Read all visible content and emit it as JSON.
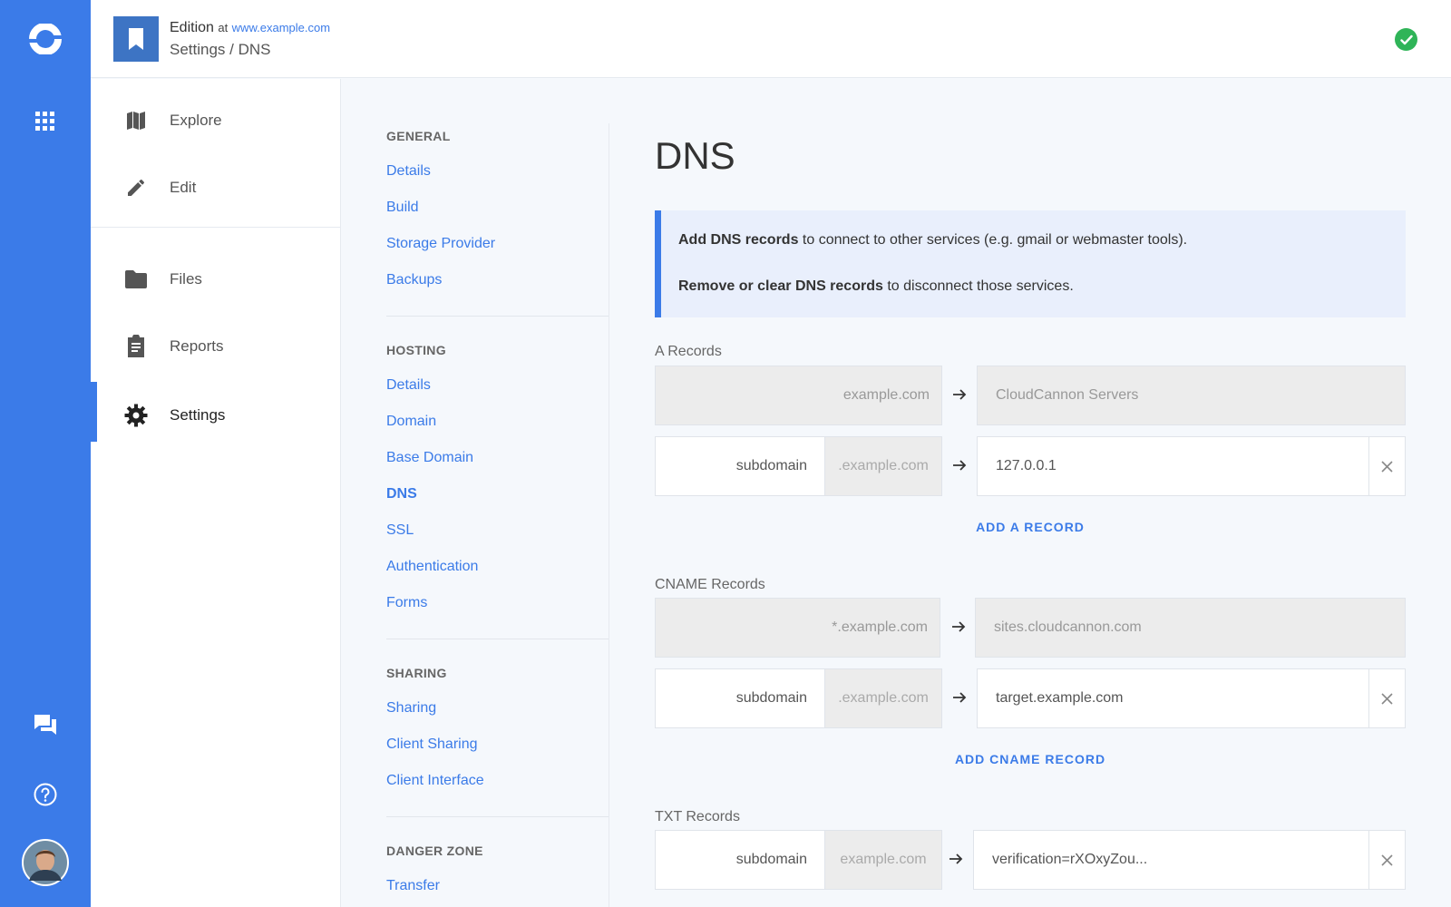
{
  "header": {
    "site_name": "Edition",
    "at_label": "at",
    "site_url": "www.example.com",
    "breadcrumb": "Settings / DNS"
  },
  "nav": {
    "items": [
      {
        "label": "Explore",
        "icon": "map-icon"
      },
      {
        "label": "Edit",
        "icon": "pencil-icon"
      },
      {
        "label": "Files",
        "icon": "folder-icon"
      },
      {
        "label": "Reports",
        "icon": "clipboard-icon"
      },
      {
        "label": "Settings",
        "icon": "gear-icon",
        "active": true
      }
    ]
  },
  "subnav": {
    "general": {
      "title": "GENERAL",
      "links": [
        "Details",
        "Build",
        "Storage Provider",
        "Backups"
      ]
    },
    "hosting": {
      "title": "HOSTING",
      "links": [
        "Details",
        "Domain",
        "Base Domain",
        "DNS",
        "SSL",
        "Authentication",
        "Forms"
      ]
    },
    "sharing": {
      "title": "SHARING",
      "links": [
        "Sharing",
        "Client Sharing",
        "Client Interface"
      ]
    },
    "danger": {
      "title": "DANGER ZONE",
      "links": [
        "Transfer"
      ]
    },
    "current": "DNS"
  },
  "main": {
    "title": "DNS",
    "info": {
      "line1_bold": "Add DNS records",
      "line1_rest": " to connect to other services (e.g. gmail or webmaster tools).",
      "line2_bold": "Remove or clear DNS records",
      "line2_rest": " to disconnect those services."
    },
    "a_records": {
      "label": "A Records",
      "fixed_host": "example.com",
      "fixed_target": "CloudCannon Servers",
      "row_name": "subdomain",
      "row_domain": ".example.com",
      "row_target": "127.0.0.1",
      "add_label": "ADD A RECORD"
    },
    "cname_records": {
      "label": "CNAME Records",
      "fixed_host": "*.example.com",
      "fixed_target": "sites.cloudcannon.com",
      "row_name": "subdomain",
      "row_domain": ".example.com",
      "row_target": "target.example.com",
      "add_label": "ADD CNAME RECORD"
    },
    "txt_records": {
      "label": "TXT Records",
      "row_name": "subdomain",
      "row_domain": "example.com",
      "row_target": "verification=rXOxyZou..."
    }
  },
  "colors": {
    "accent": "#3b7be8",
    "success": "#2fb458",
    "site_icon": "#3d74c4"
  }
}
